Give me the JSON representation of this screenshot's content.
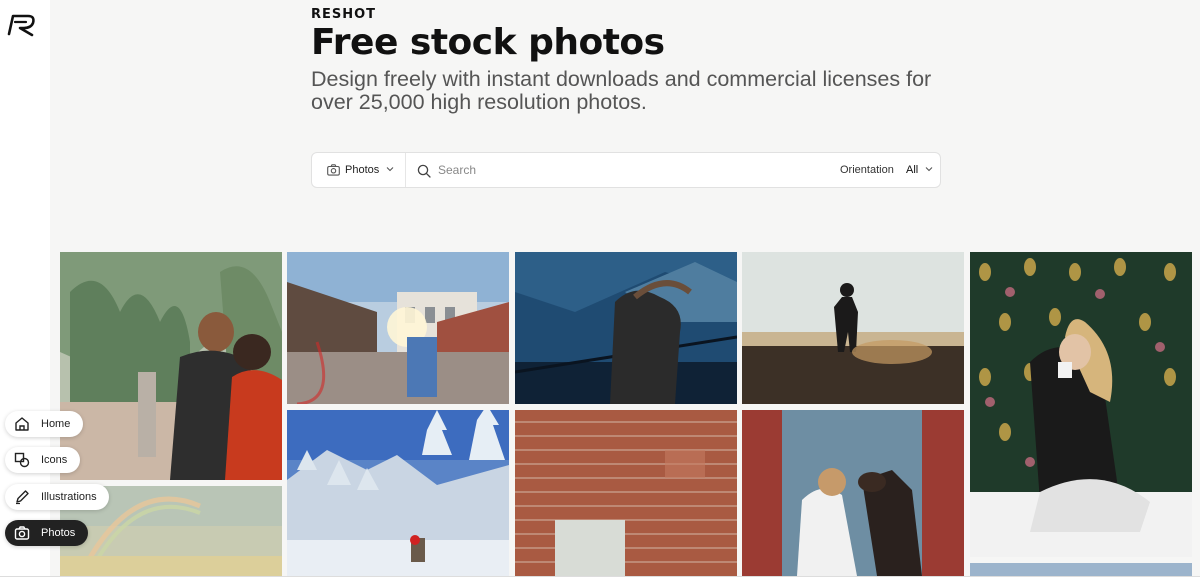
{
  "brand": "RESHOT",
  "hero": {
    "title": "Free stock photos",
    "subtitle": "Design freely with instant downloads and commercial licenses for over 25,000 high resolution photos."
  },
  "search": {
    "type_label": "Photos",
    "placeholder": "Search",
    "value": "",
    "orientation_label": "Orientation",
    "orientation_value": "All"
  },
  "nav": {
    "home": "Home",
    "icons": "Icons",
    "illustrations": "Illustrations",
    "photos": "Photos",
    "active": "photos"
  },
  "colors": {
    "accent_dark": "#222222",
    "background": "#f6f6f5"
  },
  "photos": [
    {
      "name": "woman-and-boy-among-plants",
      "icon": "photo"
    },
    {
      "name": "rainbow-sky",
      "icon": "photo"
    },
    {
      "name": "sunlit-building-balcony",
      "icon": "photo"
    },
    {
      "name": "snowy-forest-hiker",
      "icon": "photo"
    },
    {
      "name": "windswept-hair-woman-lake",
      "icon": "photo"
    },
    {
      "name": "brick-wall",
      "icon": "photo"
    },
    {
      "name": "man-standing-at-sunset",
      "icon": "photo"
    },
    {
      "name": "girl-kissing-dog",
      "icon": "photo"
    },
    {
      "name": "woman-with-mug-pineapple-wallpaper",
      "icon": "photo"
    }
  ]
}
